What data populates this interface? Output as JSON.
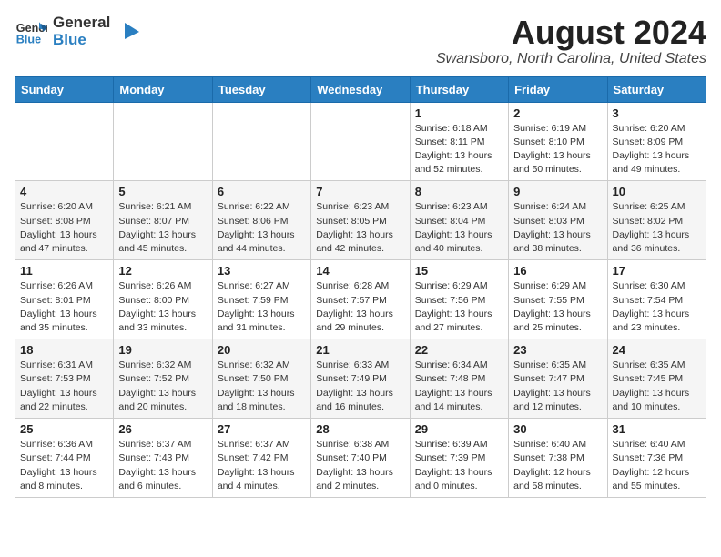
{
  "header": {
    "logo_line1": "General",
    "logo_line2": "Blue",
    "month_year": "August 2024",
    "location": "Swansboro, North Carolina, United States"
  },
  "weekdays": [
    "Sunday",
    "Monday",
    "Tuesday",
    "Wednesday",
    "Thursday",
    "Friday",
    "Saturday"
  ],
  "weeks": [
    [
      {
        "day": "",
        "info": ""
      },
      {
        "day": "",
        "info": ""
      },
      {
        "day": "",
        "info": ""
      },
      {
        "day": "",
        "info": ""
      },
      {
        "day": "1",
        "info": "Sunrise: 6:18 AM\nSunset: 8:11 PM\nDaylight: 13 hours\nand 52 minutes."
      },
      {
        "day": "2",
        "info": "Sunrise: 6:19 AM\nSunset: 8:10 PM\nDaylight: 13 hours\nand 50 minutes."
      },
      {
        "day": "3",
        "info": "Sunrise: 6:20 AM\nSunset: 8:09 PM\nDaylight: 13 hours\nand 49 minutes."
      }
    ],
    [
      {
        "day": "4",
        "info": "Sunrise: 6:20 AM\nSunset: 8:08 PM\nDaylight: 13 hours\nand 47 minutes."
      },
      {
        "day": "5",
        "info": "Sunrise: 6:21 AM\nSunset: 8:07 PM\nDaylight: 13 hours\nand 45 minutes."
      },
      {
        "day": "6",
        "info": "Sunrise: 6:22 AM\nSunset: 8:06 PM\nDaylight: 13 hours\nand 44 minutes."
      },
      {
        "day": "7",
        "info": "Sunrise: 6:23 AM\nSunset: 8:05 PM\nDaylight: 13 hours\nand 42 minutes."
      },
      {
        "day": "8",
        "info": "Sunrise: 6:23 AM\nSunset: 8:04 PM\nDaylight: 13 hours\nand 40 minutes."
      },
      {
        "day": "9",
        "info": "Sunrise: 6:24 AM\nSunset: 8:03 PM\nDaylight: 13 hours\nand 38 minutes."
      },
      {
        "day": "10",
        "info": "Sunrise: 6:25 AM\nSunset: 8:02 PM\nDaylight: 13 hours\nand 36 minutes."
      }
    ],
    [
      {
        "day": "11",
        "info": "Sunrise: 6:26 AM\nSunset: 8:01 PM\nDaylight: 13 hours\nand 35 minutes."
      },
      {
        "day": "12",
        "info": "Sunrise: 6:26 AM\nSunset: 8:00 PM\nDaylight: 13 hours\nand 33 minutes."
      },
      {
        "day": "13",
        "info": "Sunrise: 6:27 AM\nSunset: 7:59 PM\nDaylight: 13 hours\nand 31 minutes."
      },
      {
        "day": "14",
        "info": "Sunrise: 6:28 AM\nSunset: 7:57 PM\nDaylight: 13 hours\nand 29 minutes."
      },
      {
        "day": "15",
        "info": "Sunrise: 6:29 AM\nSunset: 7:56 PM\nDaylight: 13 hours\nand 27 minutes."
      },
      {
        "day": "16",
        "info": "Sunrise: 6:29 AM\nSunset: 7:55 PM\nDaylight: 13 hours\nand 25 minutes."
      },
      {
        "day": "17",
        "info": "Sunrise: 6:30 AM\nSunset: 7:54 PM\nDaylight: 13 hours\nand 23 minutes."
      }
    ],
    [
      {
        "day": "18",
        "info": "Sunrise: 6:31 AM\nSunset: 7:53 PM\nDaylight: 13 hours\nand 22 minutes."
      },
      {
        "day": "19",
        "info": "Sunrise: 6:32 AM\nSunset: 7:52 PM\nDaylight: 13 hours\nand 20 minutes."
      },
      {
        "day": "20",
        "info": "Sunrise: 6:32 AM\nSunset: 7:50 PM\nDaylight: 13 hours\nand 18 minutes."
      },
      {
        "day": "21",
        "info": "Sunrise: 6:33 AM\nSunset: 7:49 PM\nDaylight: 13 hours\nand 16 minutes."
      },
      {
        "day": "22",
        "info": "Sunrise: 6:34 AM\nSunset: 7:48 PM\nDaylight: 13 hours\nand 14 minutes."
      },
      {
        "day": "23",
        "info": "Sunrise: 6:35 AM\nSunset: 7:47 PM\nDaylight: 13 hours\nand 12 minutes."
      },
      {
        "day": "24",
        "info": "Sunrise: 6:35 AM\nSunset: 7:45 PM\nDaylight: 13 hours\nand 10 minutes."
      }
    ],
    [
      {
        "day": "25",
        "info": "Sunrise: 6:36 AM\nSunset: 7:44 PM\nDaylight: 13 hours\nand 8 minutes."
      },
      {
        "day": "26",
        "info": "Sunrise: 6:37 AM\nSunset: 7:43 PM\nDaylight: 13 hours\nand 6 minutes."
      },
      {
        "day": "27",
        "info": "Sunrise: 6:37 AM\nSunset: 7:42 PM\nDaylight: 13 hours\nand 4 minutes."
      },
      {
        "day": "28",
        "info": "Sunrise: 6:38 AM\nSunset: 7:40 PM\nDaylight: 13 hours\nand 2 minutes."
      },
      {
        "day": "29",
        "info": "Sunrise: 6:39 AM\nSunset: 7:39 PM\nDaylight: 13 hours\nand 0 minutes."
      },
      {
        "day": "30",
        "info": "Sunrise: 6:40 AM\nSunset: 7:38 PM\nDaylight: 12 hours\nand 58 minutes."
      },
      {
        "day": "31",
        "info": "Sunrise: 6:40 AM\nSunset: 7:36 PM\nDaylight: 12 hours\nand 55 minutes."
      }
    ]
  ]
}
